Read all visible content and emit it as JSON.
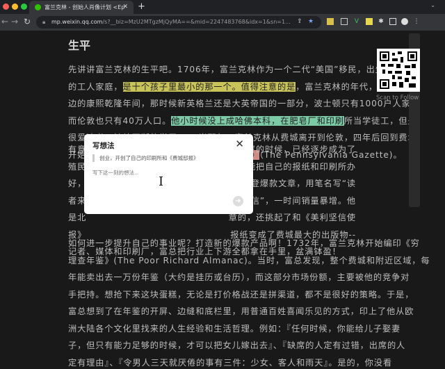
{
  "browser": {
    "tab_title": "富兰克林 - 创始人肖像计划 <Ep",
    "url_host": "mp.weixin.qq.com",
    "url_path": "/s?__biz=MzU2MTgzMjQyMA==&mid=2247483768&idx=1&sn=1..."
  },
  "article": {
    "heading": "生平",
    "p1": [
      {
        "pre": "先讲讲富兰克林的生平吧。1706年，富兰克林作为一个二代“美国”移民，出生在波士顿",
        "hl": "",
        "post": ""
      },
      {
        "pre": "的工人家庭，",
        "hl": "是十个孩子里最小的那一个。值得注意的是",
        "post": "，富兰克林的年代，是中国这"
      },
      {
        "pre": "边的康熙乾隆年间，那时候新英格兰还是大英帝国的一部分，波士顿只有1000户人家，",
        "hl": "",
        "post": ""
      },
      {
        "pre": "而伦敦也只有40万人口。",
        "hl": "他小时候没上成哈佛本科，在肥皂厂和印刷",
        "post": "所当学徒工，但是"
      },
      {
        "pre": "很爱读书，持续不断的学习。17岁那年，富兰克林从费城离开到伦敦，四年后回到费城",
        "hl": "",
        "post": ""
      },
      {
        "pre": "开始",
        "hl": "创业，开创了自己的印刷所和《费城邸报》",
        "post": "（The Pennsylvania Gazette)。"
      }
    ],
    "p2": [
      {
        "left": "有意",
        "right": "到25岁的时候，已经逐步成为了"
      },
      {
        "left": "殖民",
        "right": "了能把自己的报纸和印刷所办"
      },
      {
        "left": "好，",
        "right": "了刊登爆款文章，用笔名写“读"
      },
      {
        "left": "者来",
        "right": "者回信”，一时间销量暴增。他"
      },
      {
        "left": "是北",
        "right": "章的，还挑起了和《美利坚信使"
      },
      {
        "left": "报》",
        "right": "报纸变成了费城最大的出版物--"
      },
      {
        "left": "记者、媒体和印刷厂，富总把行业上下游全都拿在手里，盆满钵盈！",
        "right": ""
      }
    ],
    "p3": [
      "如何进一步提升自己的事业呢？打造新的爆款产品啊！1732年，富兰克林开始编印《穷",
      "理查年鉴》(The Poor Richard Almanac)。当时，富总发现，整个费城和附近区域，每",
      "年能卖出去一万份年鉴（大约是挂历或台历），而这部分市场份额，主要被他的竞争对",
      "手把持。想抢下来这块蛋糕，无论是打价格战还是拼渠道，都不是很好的策略。于是，",
      "富总想到了在年鉴的开屏、边缝和底栏里，用普通百姓喜闻乐见的方式，印上了他从欧",
      "洲大陆各个文化里找来的人生经验和生活哲理。例如：『任何时候，你能给儿子娶妻",
      "子，但只有能力足够的时候，才可以把女儿嫁出去』、『缺席的人定有过错，出席的人",
      "定有理由』、『令男人三天就厌倦的事有三件：少女、客人和雨天』。是的，你没看"
    ]
  },
  "qr": {
    "label": "Scan to Follow"
  },
  "dialog": {
    "title": "写想法",
    "quote": "创业，开创了自己的印刷所和《费城邸报》",
    "placeholder": "写下这一刻的想法..."
  }
}
